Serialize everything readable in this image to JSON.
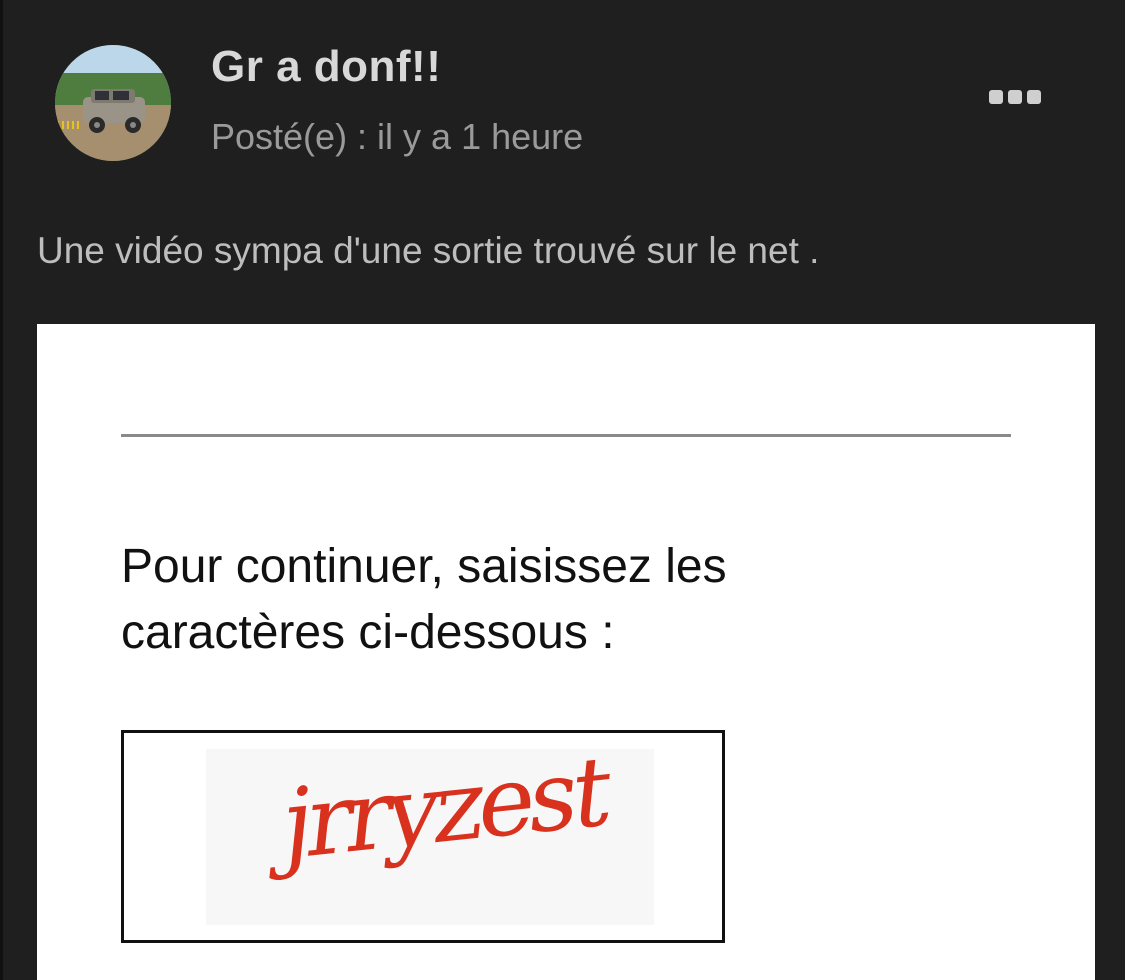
{
  "post": {
    "author": "Gr a donf!!",
    "posted": "Posté(e) : il y a 1 heure",
    "body": "Une vidéo sympa d'une sortie trouvé sur le net ."
  },
  "embed": {
    "prompt": "Pour continuer, saisissez les caractères ci-dessous :",
    "captcha_text": "jrryzest"
  },
  "icons": {
    "more": "more-options-icon",
    "avatar": "avatar"
  },
  "colors": {
    "background": "#1f1f1f",
    "author": "#d8d8d8",
    "meta": "#9a9a9a",
    "captcha": "#d8321e"
  }
}
